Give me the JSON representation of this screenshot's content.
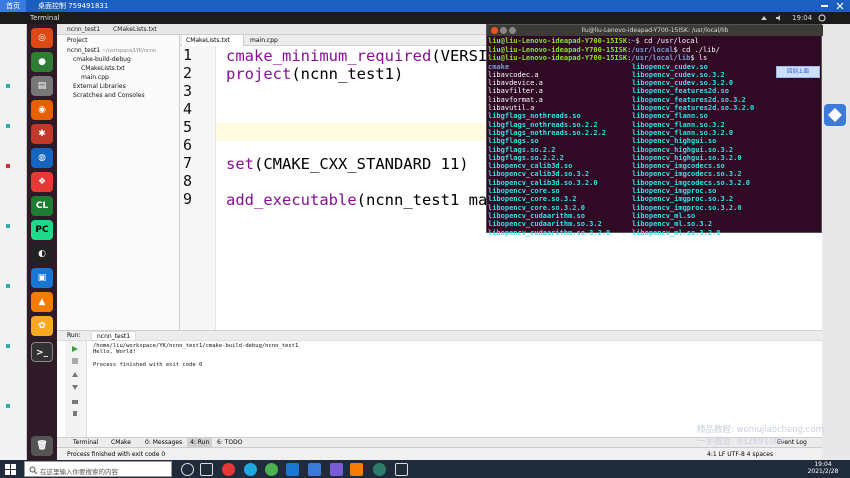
{
  "remote_bar": {
    "home_label": "首页",
    "session_title": "桌面控制 759491831"
  },
  "ubuntu_bar": {
    "app_name": "Terminal",
    "clock": "19:04"
  },
  "ide": {
    "top_tabs": [
      "ncnn_test1",
      "CMakeLists.txt"
    ],
    "project_tree": {
      "header": "Project",
      "root": "ncnn_test1",
      "root_path": "~/usr/space/LYK/ncnn",
      "items": [
        "cmake-build-debug",
        "CMakeLists.txt",
        "main.cpp"
      ],
      "external": "External Libraries",
      "scratches": "Scratches and Consoles"
    },
    "editor_tabs": [
      "CMakeLists.txt",
      "main.cpp"
    ],
    "line_numbers": [
      "1",
      "2",
      "3",
      "4",
      "5",
      "6",
      "7",
      "8",
      "9"
    ],
    "code": {
      "l1_fn": "cmake_minimum_required",
      "l1_rest": "(VERSIO",
      "l2_fn": "project",
      "l2_rest": "(ncnn_test1)",
      "l7_fn": "set",
      "l7_rest": "(CMAKE_CXX_STANDARD 11)",
      "l9_fn": "add_executable",
      "l9_rest": "(ncnn_test1 mai"
    },
    "run": {
      "label": "Run:",
      "config": "ncnn_test1",
      "output": [
        "/home/liu/workspace/YK/ncnn_test1/cmake-build-debug/ncnn_test1",
        "Hello, World!",
        "",
        "Process finished with exit code 0"
      ]
    },
    "bottom_tools": [
      "Terminal",
      "CMake",
      "0: Messages",
      "4: Run",
      "6: TODO"
    ],
    "event_log": "Event Log",
    "status_left": "Process finished with exit code 0",
    "status_right": "4:1  LF  UTF-8  4 spaces"
  },
  "terminal": {
    "title": "liu@liu-Lenovo-ideapad-Y700-15ISK: /usr/local/lib",
    "lines": [
      {
        "prompt": "liu@liu-Lenovo-ideapad-Y700-15ISK",
        "path": "~",
        "cmd": "$ cd /usr/local"
      },
      {
        "prompt": "liu@liu-Lenovo-ideapad-Y700-15ISK",
        "path": "/usr/local",
        "cmd": "$ cd ./lib/"
      },
      {
        "prompt": "liu@liu-Lenovo-ideapad-Y700-15ISK",
        "path": "/usr/local/lib",
        "cmd": "$ ls"
      }
    ],
    "left_col": [
      "cmake",
      "libavcodec.a",
      "libavdevice.a",
      "libavfilter.a",
      "libavformat.a",
      "libavutil.a",
      "libgflags_nothreads.so",
      "libgflags_nothreads.so.2.2",
      "libgflags_nothreads.so.2.2.2",
      "libgflags.so",
      "libgflags.so.2.2",
      "libgflags.so.2.2.2",
      "libopencv_calib3d.so",
      "libopencv_calib3d.so.3.2",
      "libopencv_calib3d.so.3.2.0",
      "libopencv_core.so",
      "libopencv_core.so.3.2",
      "libopencv_core.so.3.2.0",
      "libopencv_cudaarithm.so",
      "libopencv_cudaarithm.so.3.2",
      "libopencv_cudaarithm.so.3.2.0"
    ],
    "right_col": [
      "libopencv_cudev.so",
      "libopencv_cudev.so.3.2",
      "libopencv_cudev.so.3.2.0",
      "libopencv_features2d.so",
      "libopencv_features2d.so.3.2",
      "libopencv_features2d.so.3.2.0",
      "libopencv_flann.so",
      "libopencv_flann.so.3.2",
      "libopencv_flann.so.3.2.0",
      "libopencv_highgui.so",
      "libopencv_highgui.so.3.2",
      "libopencv_highgui.so.3.2.0",
      "libopencv_imgcodecs.so",
      "libopencv_imgcodecs.so.3.2",
      "libopencv_imgcodecs.so.3.2.0",
      "libopencv_imgproc.so",
      "libopencv_imgproc.so.3.2",
      "libopencv_imgproc.so.3.2.0",
      "libopencv_ml.so",
      "libopencv_ml.so.3.2",
      "libopencv_ml.so.3.2.0"
    ]
  },
  "float_button": "回到上面",
  "watermark": {
    "line1": "精品教程: woniujiaocheng.com",
    "line2": "一手微信: 932891088"
  },
  "windows_taskbar": {
    "search_placeholder": "在这里输入你要搜索的内容",
    "time": "19:04",
    "date": "2021/2/28"
  }
}
